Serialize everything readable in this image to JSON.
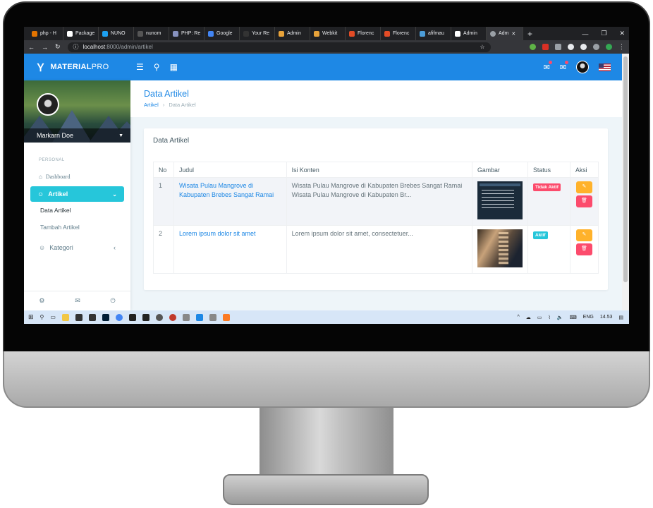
{
  "browser": {
    "tabs": [
      {
        "label": "php - H",
        "color": "#e37400"
      },
      {
        "label": "Package",
        "color": "#ffffff"
      },
      {
        "label": "NUNO",
        "color": "#1da1f2"
      },
      {
        "label": "nunom",
        "color": "#555555"
      },
      {
        "label": "PHP: Re",
        "color": "#8892bf"
      },
      {
        "label": "Google",
        "color": "#4285f4"
      },
      {
        "label": "Your Re",
        "color": "#333333"
      },
      {
        "label": "Admin",
        "color": "#e8a33a"
      },
      {
        "label": "Webkit",
        "color": "#e8a33a"
      },
      {
        "label": "Florenc",
        "color": "#e34c26"
      },
      {
        "label": "Florenc",
        "color": "#e34c26"
      },
      {
        "label": "afifmau",
        "color": "#4c9dd8"
      },
      {
        "label": "Admin",
        "color": "#ffffff"
      },
      {
        "label": "Adm",
        "color": "#9aa0a6"
      }
    ],
    "url_host": "localhost",
    "url_path": ":8000/admin/artikel"
  },
  "app": {
    "brand_bold": "MATERIAL",
    "brand_light": "PRO",
    "accent": "#1e88e5"
  },
  "sidebar": {
    "user_name": "Markarn Doe",
    "section_caption": "PERSONAL",
    "dashboard_label": "Dashboard",
    "artikel_label": "Artikel",
    "sub_items": [
      "Data Artikel",
      "Tambah Artikel"
    ],
    "kategori_label": "Kategori"
  },
  "page": {
    "title": "Data Artikel",
    "breadcrumb_root": "Artikel",
    "breadcrumb_current": "Data Artikel"
  },
  "card": {
    "title": "Data Artikel",
    "columns": [
      "No",
      "Judul",
      "Isi Konten",
      "Gambar",
      "Status",
      "Aksi"
    ],
    "rows": [
      {
        "no": "1",
        "judul": "Wisata Pulau Mangrove di Kabupaten Brebes Sangat Ramai",
        "isi": "Wisata Pulau Mangrove di Kabupaten Brebes Sangat Ramai Wisata Pulau Mangrove di Kabupaten Br...",
        "status": "Tidak Aktif",
        "status_color": "#fc4b6c"
      },
      {
        "no": "2",
        "judul": "Lorem ipsum dolor sit amet",
        "isi": "Lorem ipsum dolor sit amet, consectetuer...",
        "status": "Aktif",
        "status_color": "#26c6da"
      }
    ]
  },
  "taskbar": {
    "lang": "ENG",
    "time": "14.53"
  }
}
